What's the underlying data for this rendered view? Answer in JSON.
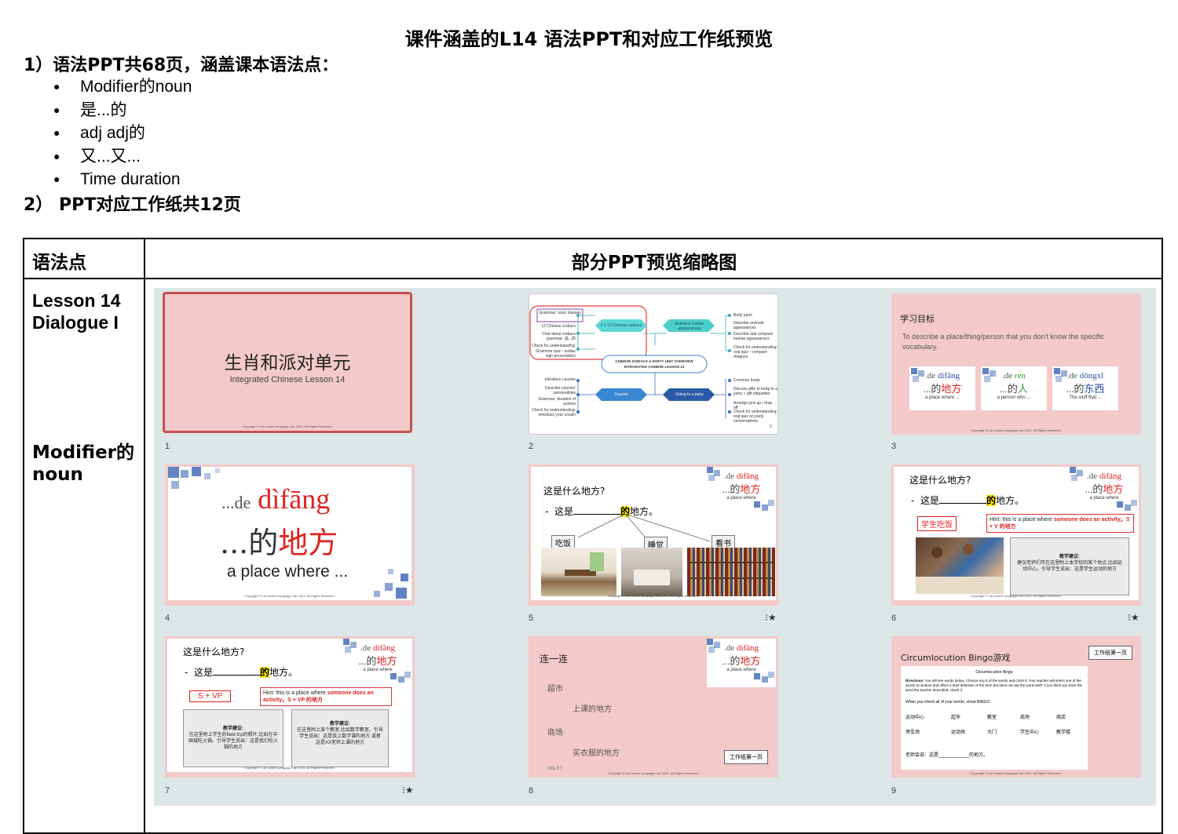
{
  "title": "课件涵盖的L14 语法PPT和对应工作纸预览",
  "section1": "1）语法PPT共68页，涵盖课本语法点：",
  "bullets": [
    "Modifier的noun",
    "是...的",
    "adj adj的",
    "又...又...",
    "Time duration"
  ],
  "section2": "2） PPT对应工作纸共12页",
  "table": {
    "col1_header": "语法点",
    "col2_header": "部分PPT预览缩略图",
    "lesson_line1": "Lesson 14",
    "lesson_line2": "Dialogue I",
    "grammar_line1": "Modifier的",
    "grammar_line2": "noun"
  },
  "copyright": "Copyright © Lai Laoshi Language Lab 2024. All Rights Reserved.",
  "slides": {
    "s1": {
      "num": "1",
      "title": "生肖和派对单元",
      "subtitle": "Integrated Chinese Lesson 14"
    },
    "s2": {
      "num": "2",
      "center_line1": "CHINESE ZODIACS & PARTY UNIT OVERVIEW",
      "center_line2": "INTEGRATED CHINESE LESSON 14",
      "hex1": "# 1 12 Chinese zodiacs",
      "hex2": "Animal & human appearances",
      "hex3": "Cousins",
      "hex4": "Going to a party",
      "left_top": [
        "Grammar: noun clauses",
        "12 Chinese zodiacs",
        "Chat about zodiacs grammar: 是...的",
        "Check for understanding:",
        "Grammar quiz - zodiac sign presentation"
      ],
      "left_bottom": [
        "Introduce cousins",
        "Describe cousins' personalities",
        "Grammar: duration of actions",
        "Check for understanding: introduce your cousin"
      ],
      "right_top": [
        "Body parts",
        "Describe animals' appearances",
        "Describe and compare human appearances",
        "Check for understanding: oral quiz - compare dragons"
      ],
      "right_bottom": [
        "Common foods",
        "Discuss gifts to bring to a party + gift etiquettes",
        "Arrange pick up / drop off",
        "Check for understanding: oral quiz on party conversations"
      ],
      "page": "2"
    },
    "s3": {
      "num": "3",
      "title": "学习目标",
      "desc": "To describe a place/thing/person that you don't know the specific vocabulary.",
      "cards": [
        {
          "py_de": ".de",
          "py_word": "dìfāng",
          "hz_de": "...的",
          "hz_word": "地方",
          "en": "a place where ..."
        },
        {
          "py_de": ".de",
          "py_word": "rén",
          "hz_de": "...的",
          "hz_word": "人",
          "en": "a person who ..."
        },
        {
          "py_de": ".de",
          "py_word": "dōngxī",
          "hz_de": "...的",
          "hz_word": "东西",
          "en": "The stuff that ..."
        }
      ]
    },
    "s4": {
      "num": "4",
      "py_de": "...de",
      "py_word": "dìfāng",
      "hz_de": "...的",
      "hz_word": "地方",
      "en": "a place where ..."
    },
    "badge": {
      "py_de": ".de",
      "py_word": "dìfāng",
      "hz_de": "...的",
      "hz_word": "地方",
      "en": "a place where"
    },
    "s5": {
      "num": "5",
      "star": "⁝★",
      "q": "这是什么地方?",
      "dash": "-",
      "ans_a": "这是",
      "ans_b": "的",
      "ans_c": "地方。",
      "tags": [
        "吃饭",
        "睡觉",
        "看书"
      ]
    },
    "s6": {
      "num": "6",
      "star": "⁝★",
      "q": "这是什么地方?",
      "dash": "-",
      "ans_a": "这是",
      "ans_b": "的",
      "ans_c": "地方。",
      "tag": "学生吃饭",
      "hint_a": "Hint: this is a place where ",
      "hint_b": "someone does an activity",
      "hint_c": "。S + V 的地方",
      "note_title": "教学建议:",
      "note_body": "建议老师们可在这里附上本学校的某个地点,比如运动中心。引导学生说出：这是学生运动的地方"
    },
    "s7": {
      "num": "7",
      "star": "⁝★",
      "q": "这是什么地方?",
      "dash": "-",
      "ans_a": "这是",
      "ans_b": "的",
      "ans_c": "地方。",
      "tag": "S + VP",
      "hint_a": "Hint: this is a place where ",
      "hint_b": "someone does an activity",
      "hint_c": "。S + VP 的地方",
      "note1_title": "教学建议:",
      "note1_body": "在这里附上学生的field trip的照片,比如在中国城吃火锅。引导学生说出：这是我们吃火锅的地方",
      "note2_title": "教学建议:",
      "note2_body": "在这里附上某个教室,比如数学教室。引导学生说出：这是我上数学课的地方 或者 这是XX老师上课的地方"
    },
    "s8": {
      "num": "8",
      "title": "连一连",
      "items": [
        "超市",
        "上课的地方",
        "商场",
        "买衣服的地方",
        "ABLS?"
      ],
      "button": "工作纸第一页"
    },
    "s9": {
      "num": "9",
      "title": "Circumlocution Bingo游戏",
      "button": "工作纸第一页",
      "sheet_title": "Circumlocution Bingo",
      "directions_label": "Directions:",
      "directions": " You will see words below. Choose any 5 of the words and circle it. Your teacher will select one of the words at random and offers a brief definition of the term but does not say the word itself. If you think you have the word the teacher described, check it.",
      "shout": "When you check all of your words, shout BINGO.",
      "row1": [
        "运动中心",
        "超市",
        "教室",
        "商场",
        "商店"
      ],
      "row2": [
        "停车场",
        "运动场",
        "大门",
        "学生中心",
        "教学楼"
      ],
      "teacher": "老师会说：这是_____________的地方。"
    }
  },
  "colors": {
    "slide_pink": "#f3c9c9",
    "grid_bg": "#dde6e6",
    "accent_red": "#d22222",
    "accent_blue": "#3a64b4",
    "highlight": "#ffea00"
  }
}
